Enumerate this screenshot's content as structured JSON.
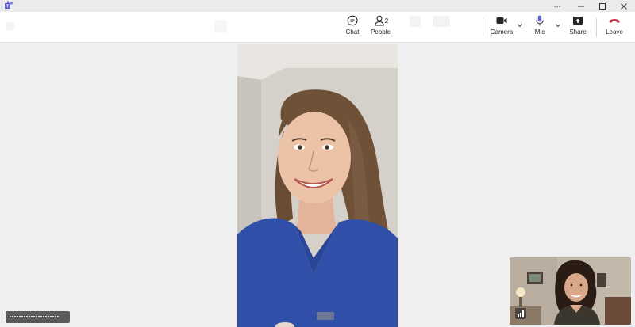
{
  "toolbar": {
    "chat_label": "Chat",
    "people_label": "People",
    "people_count": "2",
    "faded_label_1": "",
    "faded_label_2": "",
    "camera_label": "Camera",
    "mic_label": "Mic",
    "share_label": "Share",
    "leave_label": "Leave"
  },
  "window_controls": {
    "more": "···"
  },
  "participant_name_tag": "",
  "colors": {
    "leave_red": "#c4314b",
    "accent": "#5b5fc7",
    "scrubs_blue": "#2f4fa8"
  }
}
